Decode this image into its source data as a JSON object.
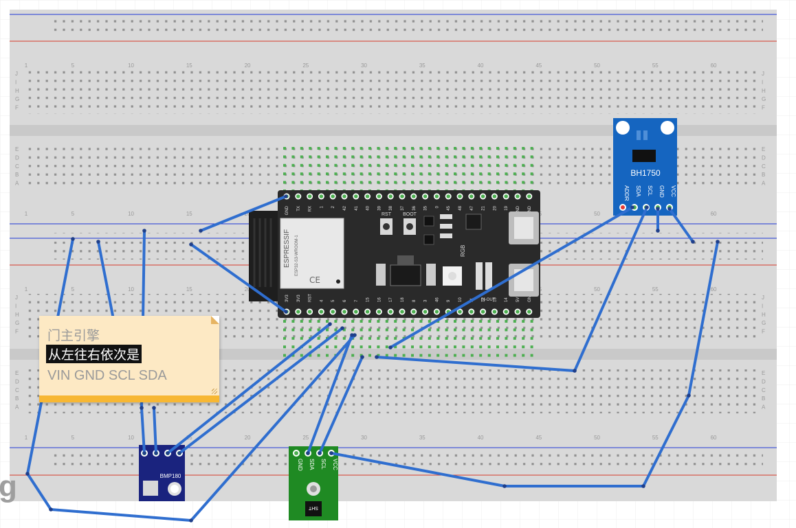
{
  "title": "门主引擎",
  "breadboards": [
    {
      "top_row_letters": [
        "J",
        "I",
        "H",
        "G",
        "F"
      ],
      "bottom_row_letters": [
        "E",
        "D",
        "C",
        "B",
        "A"
      ],
      "column_numbers": [
        "1",
        "5",
        "10",
        "15",
        "20",
        "25",
        "30",
        "35",
        "40",
        "45",
        "50",
        "55",
        "60"
      ]
    },
    {
      "top_row_letters": [
        "J",
        "I",
        "H",
        "G",
        "F"
      ],
      "bottom_row_letters": [
        "E",
        "D",
        "C",
        "B",
        "A"
      ],
      "column_numbers": [
        "1",
        "5",
        "10",
        "15",
        "20",
        "25",
        "30",
        "35",
        "40",
        "45",
        "50",
        "55",
        "60"
      ]
    }
  ],
  "esp32": {
    "top_pins": [
      "GND",
      "TX",
      "RX",
      "1",
      "2",
      "42",
      "41",
      "40",
      "39",
      "38",
      "37",
      "36",
      "35",
      "0",
      "45",
      "48",
      "47",
      "21",
      "20",
      "19",
      "GND",
      "GND"
    ],
    "bottom_pins": [
      "3V3",
      "3V3",
      "RST",
      "4",
      "5",
      "6",
      "7",
      "15",
      "16",
      "17",
      "18",
      "8",
      "3",
      "46",
      "9",
      "10",
      "11",
      "12",
      "13",
      "14",
      "5V",
      "GND"
    ],
    "module_brand": "ESPRESSIF",
    "module_model": "ESP32-S3-WROOM-1",
    "button_rst": "RST",
    "button_boot": "BOOT",
    "rgb_label": "RGB",
    "in_out_label": "IN-OUT"
  },
  "bh1750": {
    "name": "BH1750",
    "pins": [
      "ADDR",
      "SDA",
      "SCL",
      "GND",
      "VCC"
    ]
  },
  "bmp180": {
    "name": "BMP180"
  },
  "sht": {
    "name": "SHT",
    "pins": [
      "GND",
      "SDA",
      "SCL",
      "VCC"
    ]
  },
  "note": {
    "line1": "门主引擎",
    "line2": "从左往右依次是",
    "line3": "VIN GND SCL SDA"
  },
  "watermark": "g",
  "colors": {
    "wire": "#2f6ecf",
    "board_black": "#2a2a2a",
    "bh1750_blue": "#1565c0",
    "sht_green": "#1f8a23",
    "bmp180_navy": "#1a237e",
    "highlight": "#4caf50"
  }
}
